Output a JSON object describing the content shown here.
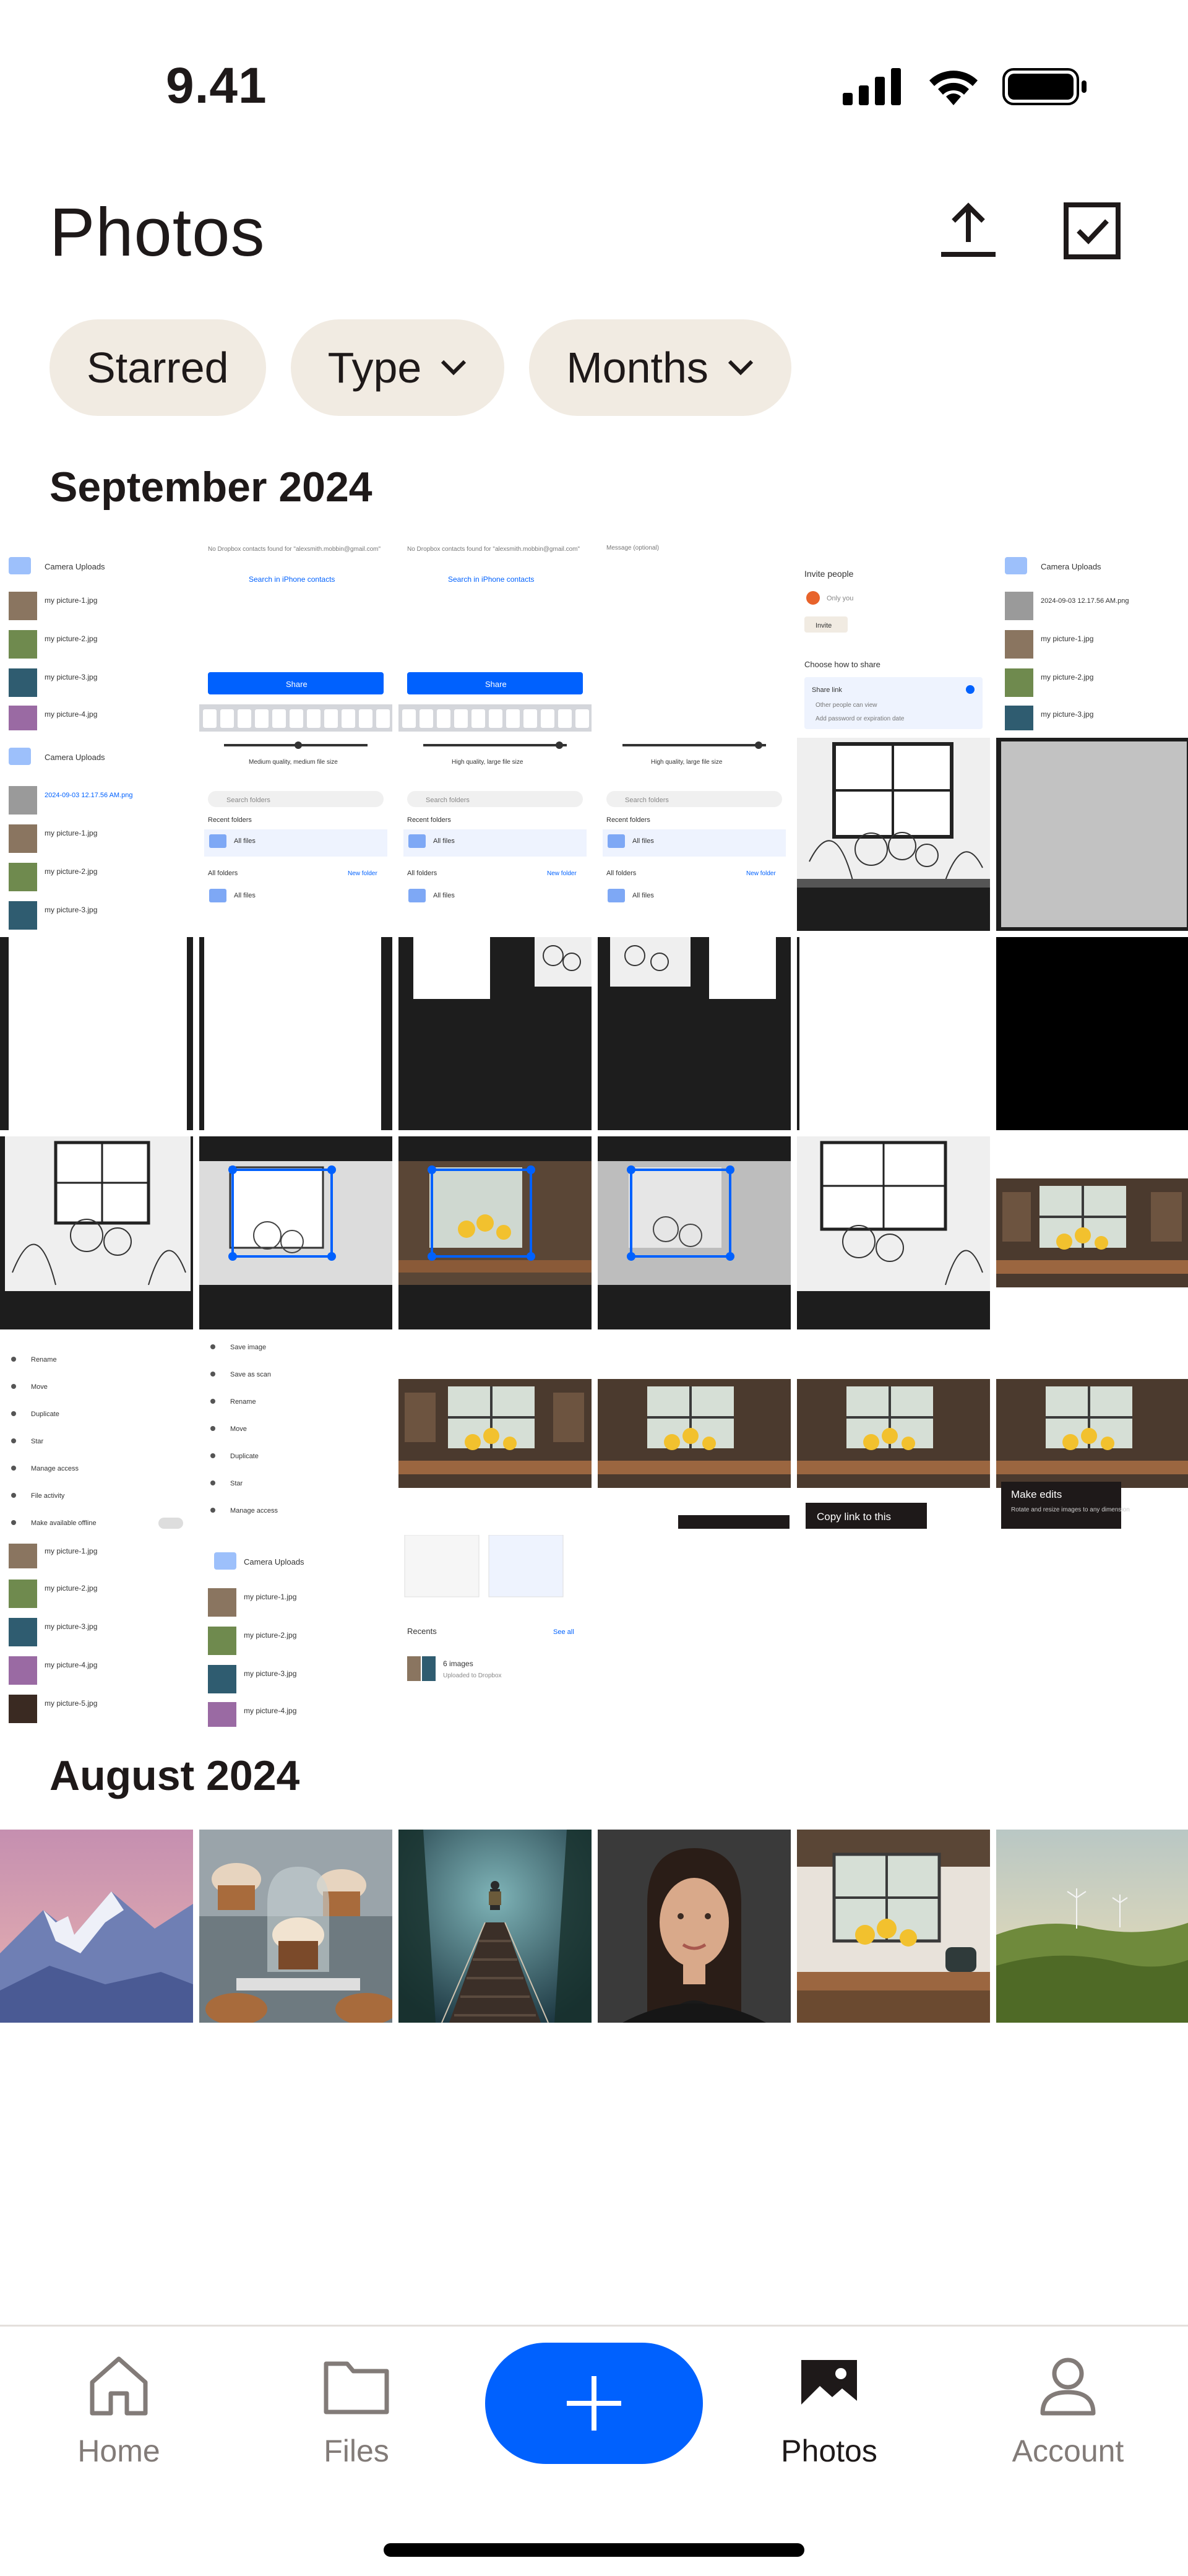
{
  "status": {
    "time": "9.41"
  },
  "header": {
    "title": "Photos"
  },
  "filters": {
    "starred": "Starred",
    "type": "Type",
    "months": "Months"
  },
  "sections": [
    {
      "label": "September 2024"
    },
    {
      "label": "August 2024"
    }
  ],
  "thumb_text": {
    "camera_uploads": "Camera Uploads",
    "pic1": "my picture-1.jpg",
    "pic2": "my picture-2.jpg",
    "pic3": "my picture-3.jpg",
    "pic4": "my picture-4.jpg",
    "pic5": "my picture-5.jpg",
    "png_name": "2024-09-03 12.17.56 AM.png",
    "no_contacts": "No Dropbox contacts found for \"alexsmith.mobbin@gmail.com\"",
    "search_iphone": "Search in iPhone contacts",
    "share": "Share",
    "medium_quality": "Medium quality, medium file size",
    "high_quality": "High quality, large file size",
    "message_optional": "Message (optional)",
    "invite_people": "Invite people",
    "only_you": "Only you",
    "invite": "Invite",
    "choose_share": "Choose how to share",
    "share_link": "Share link",
    "other_people": "Other people can view",
    "add_password": "Add password or expiration date",
    "search_folders": "Search folders",
    "recent_folders": "Recent folders",
    "all_files": "All files",
    "all_folders": "All folders",
    "new_folder": "New folder",
    "rename": "Rename",
    "move": "Move",
    "duplicate": "Duplicate",
    "star": "Star",
    "manage_access": "Manage access",
    "file_activity": "File activity",
    "make_offline": "Make available offline",
    "save_image": "Save image",
    "save_as_scan": "Save as scan",
    "recents": "Recents",
    "see_all": "See all",
    "six_images": "6 images",
    "uploaded": "Uploaded to Dropbox",
    "copy_link": "Copy link to this",
    "make_edits": "Make edits",
    "rotate_resize": "Rotate and resize images to any dimension"
  },
  "nav": {
    "home": "Home",
    "files": "Files",
    "photos": "Photos",
    "account": "Account"
  },
  "colors": {
    "accent": "#0061fe",
    "chip_bg": "#f1ebe2",
    "text": "#1e1919",
    "muted": "#827b78"
  }
}
